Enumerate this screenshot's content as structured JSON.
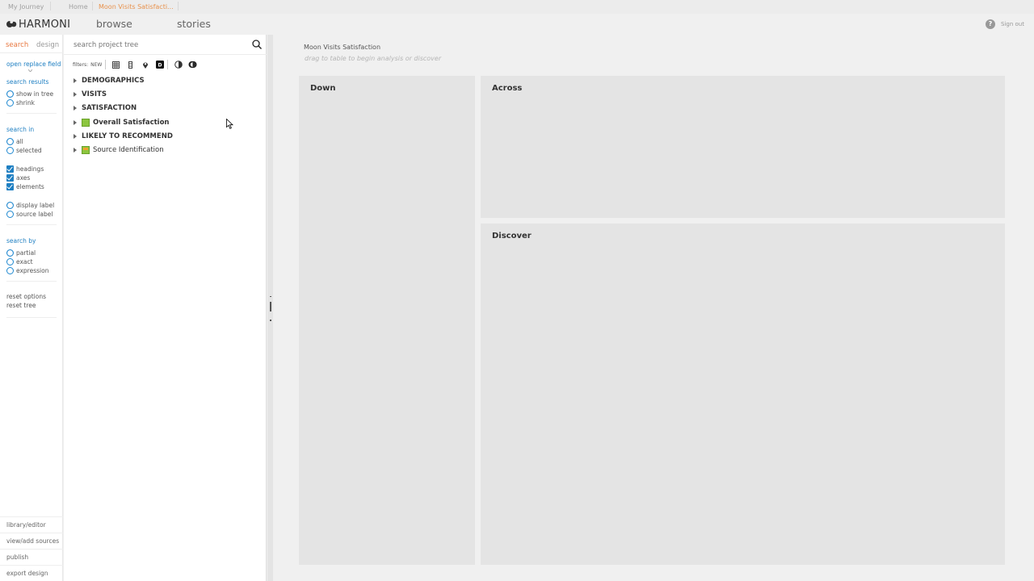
{
  "breadcrumbs": [
    "My Journey",
    "Home",
    "Moon Visits Satisfacti..."
  ],
  "header": {
    "logo": "HARMONI",
    "nav": [
      "browse",
      "stories"
    ],
    "help": "?",
    "signout": "Sign out"
  },
  "options": {
    "tabs": {
      "search": "search",
      "design": "design"
    },
    "open_replace": "open replace field",
    "search_results": {
      "heading": "search results",
      "items": [
        "show in tree",
        "shrink"
      ]
    },
    "search_in": {
      "heading": "search in",
      "scope": [
        "all",
        "selected"
      ],
      "types": [
        "headings",
        "axes",
        "elements"
      ],
      "label": [
        "display label",
        "source label"
      ]
    },
    "search_by": {
      "heading": "search by",
      "items": [
        "partial",
        "exact",
        "expression"
      ]
    },
    "reset_options": "reset options",
    "reset_tree": "reset tree",
    "footer": [
      "library/editor",
      "view/add sources",
      "publish",
      "export design"
    ]
  },
  "tree": {
    "search_placeholder": "search project tree",
    "filters_label": "filters:",
    "filters_new": "NEW",
    "nodes": [
      {
        "label": "DEMOGRAPHICS",
        "icon": "none"
      },
      {
        "label": "VISITS",
        "icon": "none"
      },
      {
        "label": "SATISFACTION",
        "icon": "none"
      },
      {
        "label": "Overall Satisfaction",
        "icon": "green-variable-icon"
      },
      {
        "label": "LIKELY TO RECOMMEND",
        "icon": "none"
      },
      {
        "label": "Source Identification",
        "icon": "source-variable-icon"
      }
    ]
  },
  "canvas": {
    "title": "Moon Visits Satisfaction",
    "hint": "drag to table to begin analysis or discover",
    "zones": {
      "down": "Down",
      "across": "Across",
      "discover": "Discover"
    }
  },
  "colors": {
    "accent_orange": "#e8773f",
    "link_blue": "#1e7fc2",
    "zone_grey": "#e4e4e4"
  }
}
